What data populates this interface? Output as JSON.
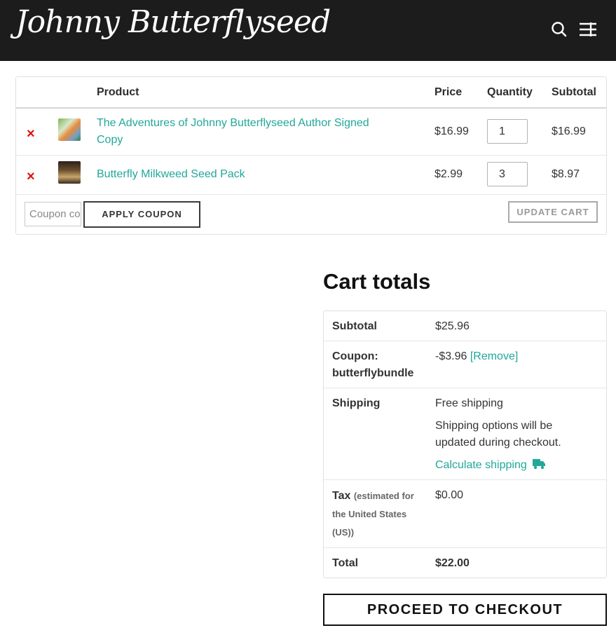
{
  "header": {
    "logo_text": "Johnny Butterflyseed",
    "search_icon": "search-icon",
    "menu_icon": "menu-icon"
  },
  "cart": {
    "columns": {
      "product": "Product",
      "price": "Price",
      "quantity": "Quantity",
      "subtotal": "Subtotal"
    },
    "items": [
      {
        "name_line1": "The Adventures of Johnny Butterflyseed Author Signed",
        "name_line2": "Copy",
        "price": "$16.99",
        "quantity": "1",
        "subtotal": "$16.99"
      },
      {
        "name_line1": "Butterfly Milkweed Seed Pack",
        "price": "$2.99",
        "quantity": "3",
        "subtotal": "$8.97"
      }
    ],
    "remove_symbol": "×",
    "coupon_placeholder": "Coupon code",
    "apply_coupon_label": "APPLY COUPON",
    "update_cart_label": "UPDATE CART"
  },
  "totals": {
    "title": "Cart totals",
    "subtotal_label": "Subtotal",
    "subtotal_value": "$25.96",
    "coupon_label_line1": "Coupon:",
    "coupon_label_line2": "butterflybundle",
    "coupon_value": "-$3.96",
    "coupon_remove": "[Remove]",
    "shipping_label": "Shipping",
    "shipping_value": "Free shipping",
    "shipping_note_line1": "Shipping options will be",
    "shipping_note_line2": "updated during checkout.",
    "calculate_shipping": "Calculate shipping",
    "tax_label": "Tax",
    "tax_note_line1": "(estimated for",
    "tax_note_line2": "the United States",
    "tax_note_line3": "(US))",
    "tax_value": "$0.00",
    "total_label": "Total",
    "total_value": "$22.00",
    "checkout_label": "PROCEED TO CHECKOUT"
  },
  "colors": {
    "accent": "#21a89a",
    "header_bg": "#1c1c1c",
    "remove": "#e01010"
  }
}
